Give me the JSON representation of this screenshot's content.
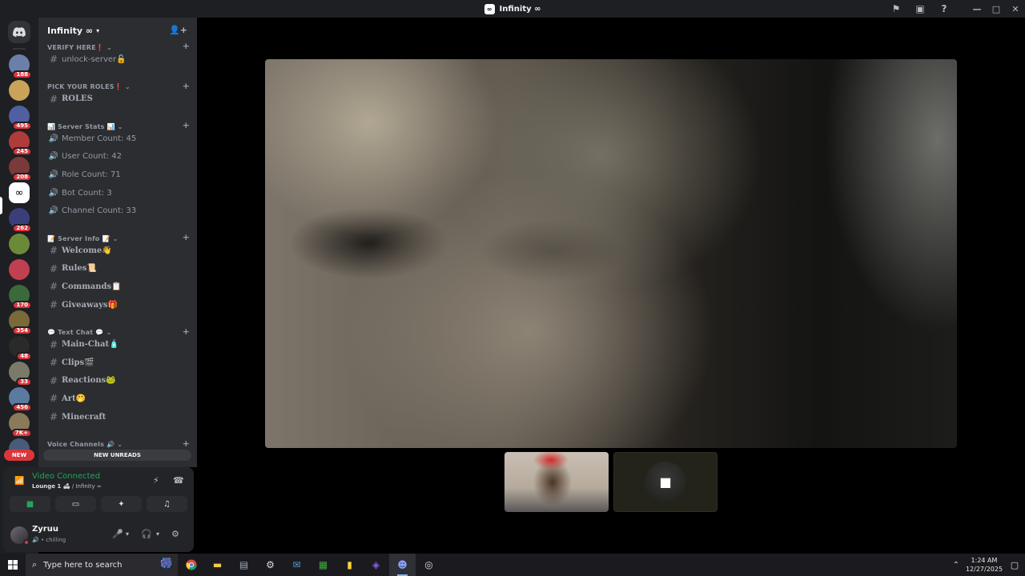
{
  "window": {
    "title": "Infinity ∞",
    "logo_text": "∞",
    "right_icons": [
      "flag-icon",
      "screen-share-icon",
      "help-icon"
    ],
    "controls": [
      "—",
      "□",
      "✕"
    ]
  },
  "rail": {
    "home_icon": "discord-logo-icon",
    "servers": [
      {
        "badge": "188",
        "color": "#6b7fa8"
      },
      {
        "badge": "",
        "color": "#c9a35a"
      },
      {
        "badge": "495",
        "color": "#4f5fa0"
      },
      {
        "badge": "245",
        "color": "#b03b3b"
      },
      {
        "badge": "208",
        "color": "#7a3a3a"
      },
      {
        "badge": "",
        "color": "#ffffff",
        "active": true,
        "glyph": "∞"
      },
      {
        "badge": "262",
        "color": "#3a3e7a"
      },
      {
        "badge": "",
        "color": "#6a8a3a"
      },
      {
        "badge": "",
        "color": "#c04050"
      },
      {
        "badge": "170",
        "color": "#3a6a3a"
      },
      {
        "badge": "354",
        "color": "#7a6a3a"
      },
      {
        "badge": "48",
        "color": "#2a2a2a"
      },
      {
        "badge": "33",
        "color": "#7a7a6a"
      },
      {
        "badge": "456",
        "color": "#5a7aa0"
      },
      {
        "badge": "7K+",
        "color": "#8a7a5a"
      },
      {
        "badge": "",
        "color": "#4a5a7a"
      }
    ],
    "new_label": "NEW"
  },
  "guild": {
    "name": "Infinity ∞",
    "categories": [
      {
        "label": "VERIFY HERE❗",
        "channels": [
          {
            "type": "text",
            "name": "unlock-server🔓"
          }
        ]
      },
      {
        "label": "PICK YOUR ROLES❗",
        "channels": [
          {
            "type": "text",
            "name": "ROLES",
            "serif": true
          }
        ]
      },
      {
        "label": "📊 Server Stats 📊",
        "channels": [
          {
            "type": "voice",
            "name": "Member Count: 45"
          },
          {
            "type": "voice",
            "name": "User Count: 42"
          },
          {
            "type": "voice",
            "name": "Role Count: 71"
          },
          {
            "type": "voice",
            "name": "Bot Count: 3"
          },
          {
            "type": "voice",
            "name": "Channel Count: 33"
          }
        ]
      },
      {
        "label": "📝 Server Info 📝",
        "channels": [
          {
            "type": "text",
            "name": "Welcome👋",
            "serif": true
          },
          {
            "type": "text",
            "name": "Rules📜",
            "serif": true
          },
          {
            "type": "text",
            "name": "Commands📋",
            "serif": true
          },
          {
            "type": "text",
            "name": "Giveaways🎁",
            "serif": true
          }
        ]
      },
      {
        "label": "💬 Text Chat 💬",
        "channels": [
          {
            "type": "text",
            "name": "Main-Chat🧴",
            "serif": true
          },
          {
            "type": "text",
            "name": "Clips🎬",
            "serif": true
          },
          {
            "type": "text",
            "name": "Reactions🐸",
            "serif": true
          },
          {
            "type": "text",
            "name": "Art🤭",
            "serif": true
          },
          {
            "type": "text",
            "name": "Minecraft",
            "serif": true
          }
        ]
      },
      {
        "label": "Voice Channels 🔊",
        "channels": []
      }
    ],
    "new_unreads": "NEW UNREADS"
  },
  "voice": {
    "status": "Video Connected",
    "channel": "Lounge 1 🛋",
    "server": "/ Infinity ∞",
    "buttons": [
      "camera-icon",
      "screen-share-icon",
      "activities-icon",
      "soundboard-icon"
    ]
  },
  "user": {
    "name": "Zyruu",
    "status": "chilling",
    "status_color": "#da373c"
  },
  "taskbar": {
    "search_placeholder": "Type here to search",
    "time": "1:24 AM",
    "date": "12/27/2025",
    "apps": [
      "chrome-icon",
      "file-explorer-icon",
      "app-icon",
      "settings-icon",
      "mail-icon",
      "spreadsheet-icon",
      "sticky-notes-icon",
      "app-icon-2",
      "discord-icon",
      "app-icon-3"
    ]
  }
}
